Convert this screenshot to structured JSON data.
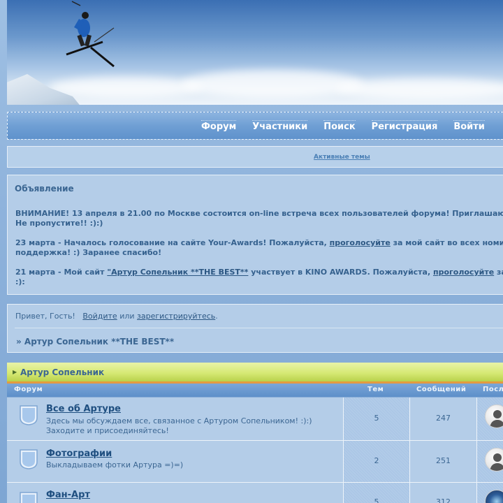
{
  "nav": {
    "items": [
      "Форум",
      "Участники",
      "Поиск",
      "Регистрация",
      "Войти"
    ]
  },
  "active_topics": "Активные темы",
  "announcement": {
    "title": "Объявление",
    "l1": "ВНИМАНИЕ! 13 апреля в 21.00 по Москве состоится on-line встреча всех пользователей форума! Приглашаю",
    "l2": "Не пропустите!! :):)",
    "l3_pre": "23 марта - Началось голосование на сайте Your-Awards! Пожалуйста, ",
    "l3_link": "проголосуйте",
    "l3_post": " за мой сайт во всех номи",
    "l4": "поддержка! :) Заранее спасибо!",
    "l5_pre": "21 марта - Мой сайт ",
    "l5_link1": "\"Артур Сопельник **THE BEST**",
    "l5_mid": " участвует в KINO AWARDS. Пожалуйста, ",
    "l5_link2": "проголосуйте",
    "l5_post": " за",
    "l6": ":):"
  },
  "greeting": {
    "hello": "Привет, Гость!",
    "login": "Войдите",
    "or": "или",
    "register": "зарегистрируйтесь",
    "dot": "."
  },
  "breadcrumb": "» Артур Сопельник **THE BEST**",
  "category": {
    "title": "Артур Сопельник"
  },
  "table": {
    "col_forum": "Форум",
    "col_topics": "Тем",
    "col_posts": "Сообщений",
    "col_last": "Посл",
    "rows": [
      {
        "name": "Все об Артуре",
        "desc1": "Здесь мы обсуждаем все, связанное с Артуром Сопельником! :):)",
        "desc2": "Заходите и присоединяйтесь!",
        "topics": "5",
        "posts": "247"
      },
      {
        "name": "Фотографии",
        "desc1": "Выкладываем фотки Артура =)=)",
        "desc2": "",
        "topics": "2",
        "posts": "251"
      },
      {
        "name": "Фан-Арт",
        "desc1": "",
        "desc2": "",
        "topics": "5",
        "posts": "312"
      }
    ]
  }
}
